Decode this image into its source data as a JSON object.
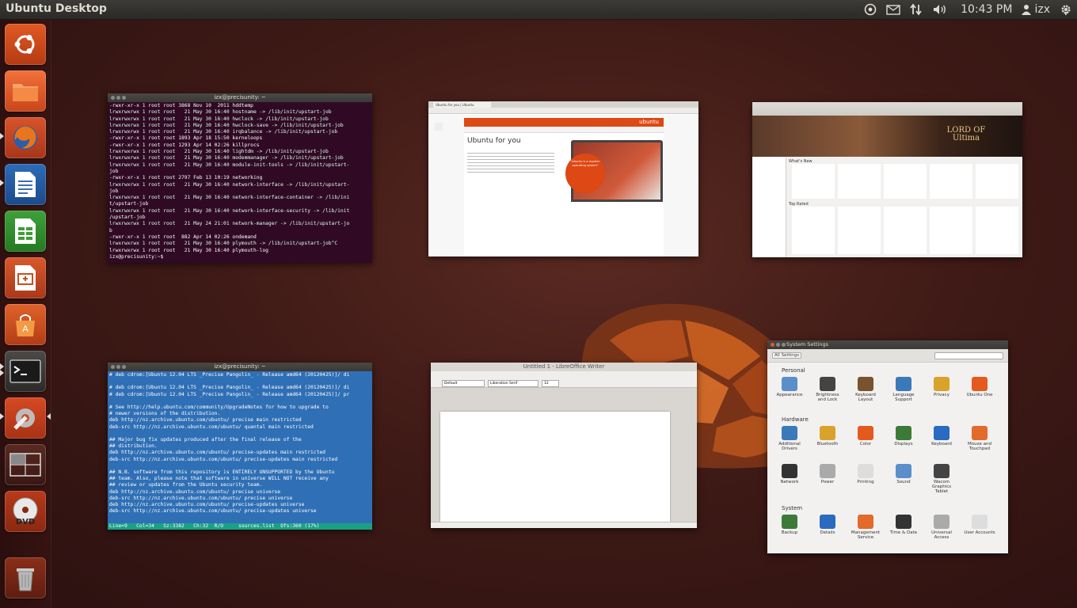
{
  "panel": {
    "title": "Ubuntu Desktop",
    "time": "10:43 PM",
    "user": "izx",
    "indicators": [
      "ubuntu-one-icon",
      "mail-icon",
      "network-icon",
      "volume-icon",
      "user-icon",
      "gear-icon"
    ]
  },
  "launcher": {
    "items": [
      "dash-home",
      "files",
      "firefox",
      "libreoffice-writer",
      "libreoffice-calc",
      "libreoffice-impress",
      "ubuntu-software-center",
      "terminal",
      "system-settings",
      "workspace-switcher",
      "dvd",
      "trash"
    ]
  },
  "windows": {
    "terminal1": {
      "title": "izx@precisunity: ~",
      "lines": [
        "-rwxr-xr-x 1 root root 3868 Nov 10  2011 hddtemp",
        "lrwxrwxrwx 1 root root   21 May 30 16:40 hostname -> /lib/init/upstart-job",
        "lrwxrwxrwx 1 root root   21 May 30 16:40 hwclock -> /lib/init/upstart-job",
        "lrwxrwxrwx 1 root root   21 May 30 16:40 hwclock-save -> /lib/init/upstart-job",
        "lrwxrwxrwx 1 root root   21 May 30 16:40 irqbalance -> /lib/init/upstart-job",
        "-rwxr-xr-x 1 root root 1893 Apr 18 15:50 kerneloops",
        "-rwxr-xr-x 1 root root 1293 Apr 14 02:26 killprocs",
        "lrwxrwxrwx 1 root root   21 May 30 16:40 lightdm -> /lib/init/upstart-job",
        "lrwxrwxrwx 1 root root   21 May 30 16:40 modemmanager -> /lib/init/upstart-job",
        "lrwxrwxrwx 1 root root   21 May 30 16:40 module-init-tools -> /lib/init/upstart-",
        "job",
        "-rwxr-xr-x 1 root root 2797 Feb 13 10:19 networking",
        "lrwxrwxrwx 1 root root   21 May 30 16:40 network-interface -> /lib/init/upstart-",
        "job",
        "lrwxrwxrwx 1 root root   21 May 30 16:40 network-interface-container -> /lib/ini",
        "t/upstart-job",
        "lrwxrwxrwx 1 root root   21 May 30 16:40 network-interface-security -> /lib/init",
        "/upstart-job",
        "lrwxrwxrwx 1 root root   21 May 24 21:01 network-manager -> /lib/init/upstart-jo",
        "b",
        "-rwxr-xr-x 1 root root  882 Apr 14 02:26 ondemand",
        "lrwxrwxrwx 1 root root   21 May 30 16:40 plymouth -> /lib/init/upstart-job^C",
        "lrwxrwxrwx 1 root root   21 May 30 16:40 plymouth-log",
        "izx@precisunity:~$ "
      ]
    },
    "firefox": {
      "tab": "Ubuntu for you | Ubuntu",
      "brand": "ubuntu",
      "heading": "Ubuntu for you",
      "bubble": "\"Ubuntu is a modern operating system\""
    },
    "software_center": {
      "banner": "LORD OF Ultima",
      "whats_new": "What's New",
      "top_rated": "Top Rated"
    },
    "terminal2": {
      "title": "izx@precisunity: ~",
      "lines": [
        "# deb cdrom:[Ubuntu 12.04 LTS _Precise Pangolin_ - Release amd64 (20120425)]/ di",
        "",
        "# deb cdrom:[Ubuntu 12.04 LTS _Precise Pangolin_ - Release amd64 (20120425)]/ di",
        "# deb cdrom:[Ubuntu 12.04 LTS _Precise Pangolin_ - Release amd64 (20120425)]/ pr",
        "",
        "# See http://help.ubuntu.com/community/UpgradeNotes for how to upgrade to",
        "# newer versions of the distribution.",
        "deb http://nz.archive.ubuntu.com/ubuntu/ precise main restricted",
        "deb-src http://nz.archive.ubuntu.com/ubuntu/ quantal main restricted",
        "",
        "## Major bug fix updates produced after the final release of the",
        "## distribution.",
        "deb http://nz.archive.ubuntu.com/ubuntu/ precise-updates main restricted",
        "deb-src http://nz.archive.ubuntu.com/ubuntu/ precise-updates main restricted",
        "",
        "## N.B. software from this repository is ENTIRELY UNSUPPORTED by the Ubuntu",
        "## team. Also, please note that software in universe WILL NOT receive any",
        "## review or updates from the Ubuntu security team.",
        "deb http://nz.archive.ubuntu.com/ubuntu/ precise universe",
        "deb-src http://nz.archive.ubuntu.com/ubuntu/ precise universe",
        "deb http://nz.archive.ubuntu.com/ubuntu/ precise-updates universe",
        "deb-src http://nz.archive.ubuntu.com/ubuntu/ precise-updates universe"
      ],
      "status": "Line=9   Col=34   Sz:3382   Ch:32  R/O     sources.list  Ofs:360 (17%)"
    },
    "writer": {
      "title": "Untitled 1 - LibreOffice Writer",
      "style": "Default",
      "font": "Liberation Serif",
      "size": "12"
    },
    "settings": {
      "title": "System Settings",
      "all_settings": "All Settings",
      "groups": [
        {
          "name": "Personal",
          "items": [
            "Appearance",
            "Brightness and Lock",
            "Keyboard Layout",
            "Language Support",
            "Privacy",
            "Ubuntu One"
          ]
        },
        {
          "name": "Hardware",
          "items": [
            "Additional Drivers",
            "Bluetooth",
            "Color",
            "Displays",
            "Keyboard",
            "Mouse and Touchpad",
            "Network",
            "Power",
            "Printing",
            "Sound",
            "Wacom Graphics Tablet"
          ]
        },
        {
          "name": "System",
          "items": [
            "Backup",
            "Details",
            "Management Service",
            "Time & Date",
            "Universal Access",
            "User Accounts"
          ]
        }
      ]
    }
  },
  "colors": {
    "accent": "#dd4814",
    "terminal_bg": "#300a24",
    "nano_bg": "#2f6fb5"
  }
}
